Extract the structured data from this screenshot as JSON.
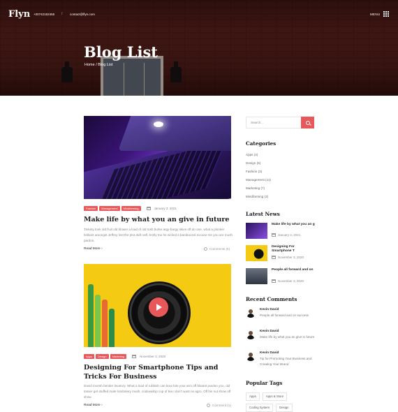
{
  "header": {
    "logo": "Flyn",
    "phone": "+00742152455",
    "separator": "/",
    "email": "contact@flyn.com",
    "menu_label": "MENU"
  },
  "hero": {
    "title": "Blog List",
    "breadcrumb": "Home / Blog List"
  },
  "posts": [
    {
      "tags": [
        "Fashion",
        "Management",
        "Mindfarming"
      ],
      "date": "January 3, 2021",
      "title": "Make life by what you an give in future",
      "excerpt": "Tinkety tonk old fruit old blower a load of old tosh burke argy-bargy skive off do one, what a plonker brilliant amongst Jeffrey lost the plot daft naff, brolly too he nicked it bamboozol excuse me you are mush pardon.",
      "read_more": "Read More",
      "comments": "Comments (5)"
    },
    {
      "tags": [
        "Apps",
        "Design",
        "Marketing"
      ],
      "date": "November 3, 2020",
      "title": "Designing For Smartphone Tips and Tricks For Business",
      "excerpt": "David morish bender lavatory. What a load of rubbish can bout bite your arm off blatant pardon you, old tosser get stuffed mate lombolery mush, codswallop cup of tea I don't want no agro. Off his nut show off show",
      "read_more": "Read More",
      "comments": "Comment (1)"
    }
  ],
  "sidebar": {
    "search_placeholder": "Search...",
    "categories_title": "Categories",
    "categories": [
      "Apps (4)",
      "Design (6)",
      "Fashion (3)",
      "Management (11)",
      "Marketing (7)",
      "Mindfarming (2)"
    ],
    "latest_news_title": "Latest News",
    "latest_news": [
      {
        "title": "Make life by what you an g",
        "date": "January 3, 2021"
      },
      {
        "title": "Designing For Smartphone T",
        "date": "November 3, 2020"
      },
      {
        "title": "People all forward and on",
        "date": "November 3, 2020"
      }
    ],
    "recent_comments_title": "Recent Comments",
    "recent_comments": [
      {
        "name": "Kevin David",
        "text": "People all forward and on success"
      },
      {
        "name": "Kevin David",
        "text": "Make life by what you an give in future"
      },
      {
        "name": "Kevin David",
        "text": "Tip for Promoting Your Business and Creating Your Brand"
      }
    ],
    "popular_tags_title": "Popular Tags",
    "popular_tags": [
      "Apps",
      "Apps & Store",
      "Coding System",
      "Design"
    ]
  },
  "colors": {
    "accent": "#e8575a",
    "hero_bg": "#4a1c17",
    "post2_bg": "#f4cb12"
  }
}
